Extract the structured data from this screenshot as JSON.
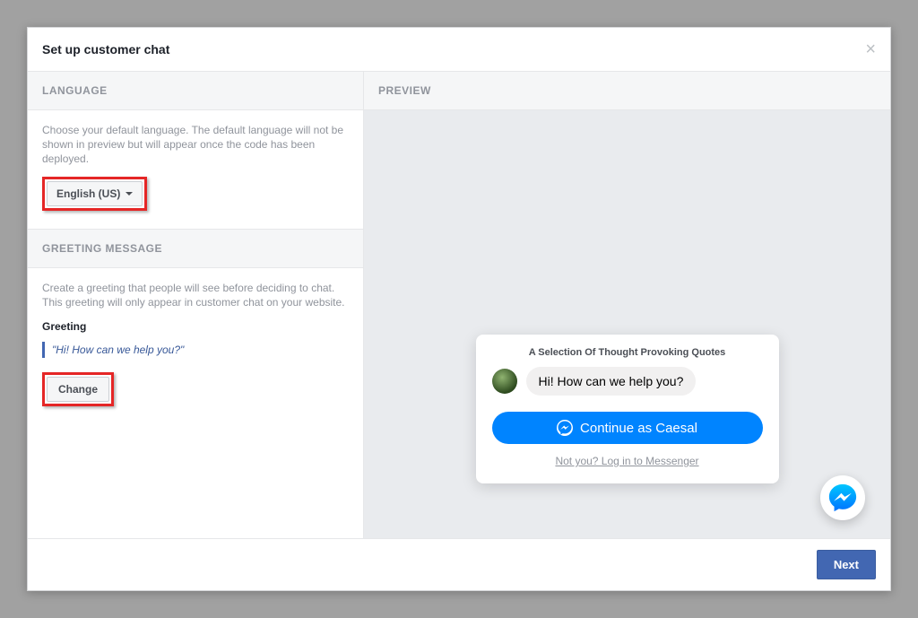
{
  "header": {
    "title": "Set up customer chat"
  },
  "sidebar": {
    "language": {
      "section_label": "LANGUAGE",
      "helper": "Choose your default language. The default language will not be shown in preview but will appear once the code has been deployed.",
      "selected": "English (US)"
    },
    "greeting": {
      "section_label": "GREETING MESSAGE",
      "helper": "Create a greeting that people will see before deciding to chat. This greeting will only appear in customer chat on your website.",
      "field_label": "Greeting",
      "value": "\"Hi! How can we help you?\"",
      "change_label": "Change"
    }
  },
  "preview": {
    "section_label": "PREVIEW",
    "chat": {
      "page_name": "A Selection Of Thought Provoking Quotes",
      "greeting_text": "Hi! How can we help you?",
      "continue_label": "Continue as Caesal",
      "not_you": "Not you? Log in to Messenger"
    }
  },
  "footer": {
    "next_label": "Next"
  }
}
